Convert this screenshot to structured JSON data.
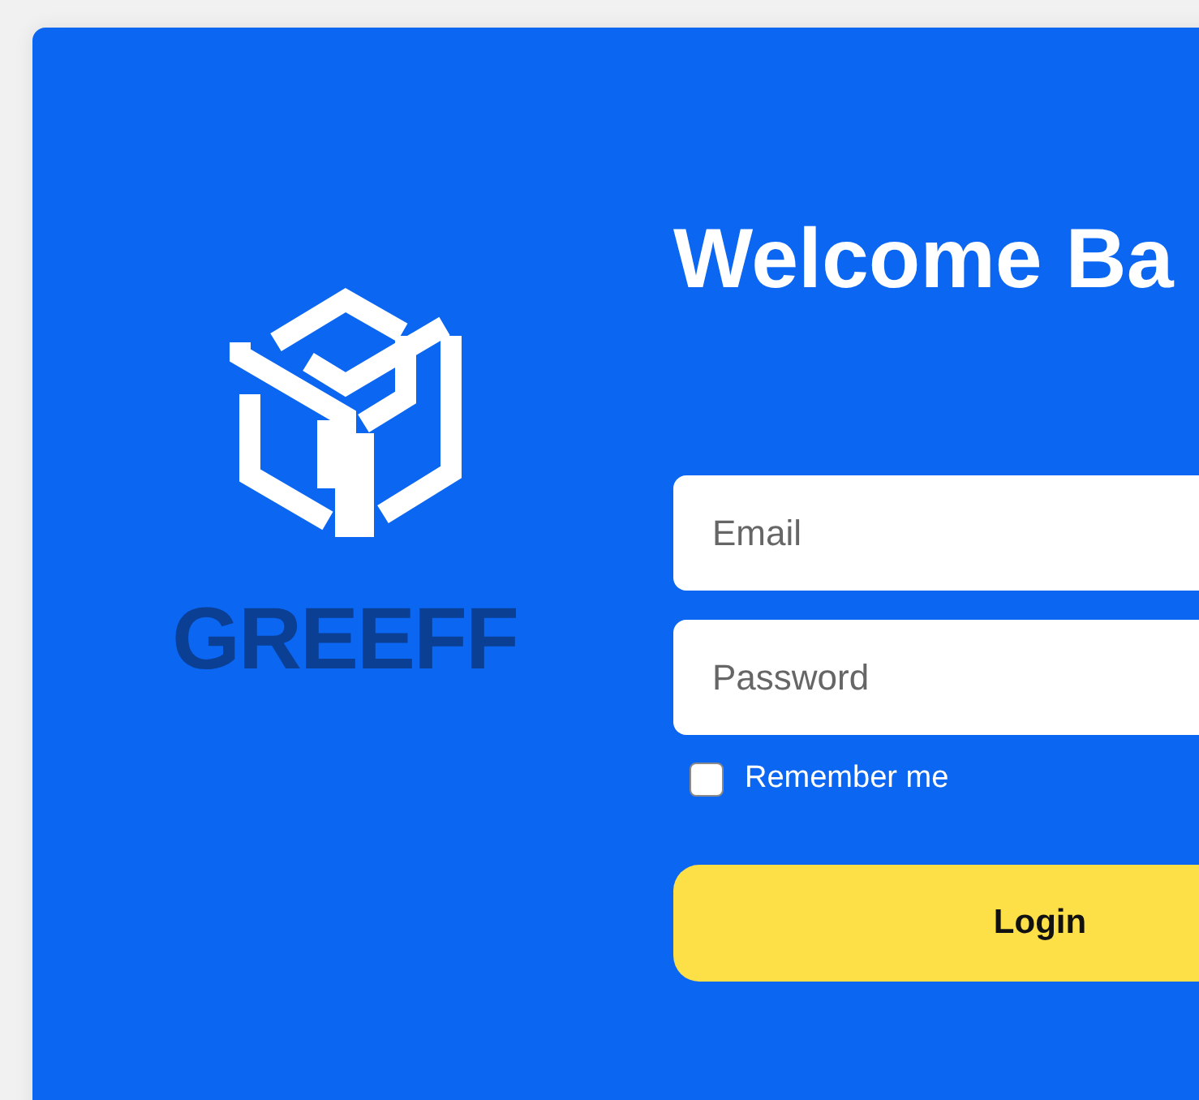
{
  "brand": {
    "name": "GREEFF"
  },
  "login": {
    "title": "Welcome Ba",
    "fields": [
      {
        "placeholder": "Email"
      },
      {
        "placeholder": "Password"
      }
    ],
    "remember": {
      "label": "Remember me",
      "checked": false
    },
    "submit": "Login"
  }
}
